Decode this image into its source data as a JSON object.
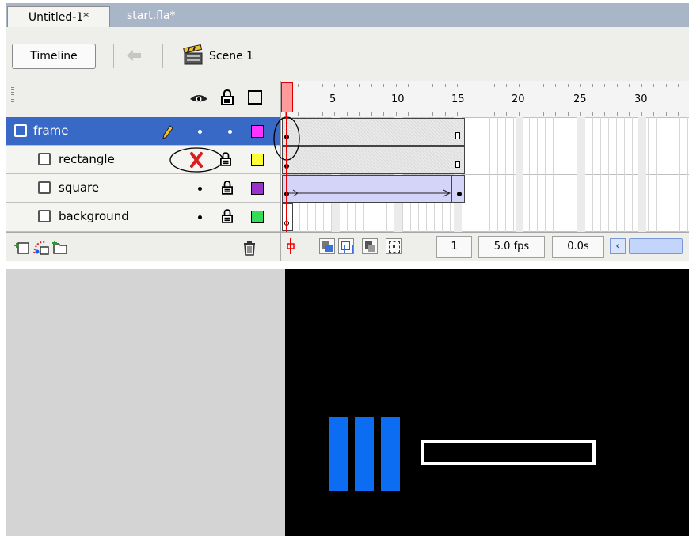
{
  "tabs": [
    {
      "label": "Untitled-1*",
      "active": true
    },
    {
      "label": "start.fla*",
      "active": false
    }
  ],
  "toolbar": {
    "timeline_label": "Timeline",
    "scene_label": "Scene 1"
  },
  "ruler": {
    "labels": [
      "1",
      "5",
      "10",
      "15",
      "20",
      "25",
      "30"
    ]
  },
  "layers": [
    {
      "name": "frame",
      "selected": true,
      "visibility": "pencil",
      "lock": "dot",
      "color": "#ff33ff",
      "frames": "tween"
    },
    {
      "name": "rectangle",
      "selected": false,
      "visibility": "hidden-x",
      "lock": "lock",
      "color": "#ffff33",
      "frames": "tween"
    },
    {
      "name": "square",
      "selected": false,
      "visibility": "dot",
      "lock": "lock",
      "color": "#9933cc",
      "frames": "motion"
    },
    {
      "name": "background",
      "selected": false,
      "visibility": "dot",
      "lock": "lock",
      "color": "#33dd55",
      "frames": "single"
    }
  ],
  "timeline_status": {
    "current_frame": "1",
    "frame_rate": "5.0 fps",
    "elapsed": "0.0s"
  },
  "icons": {
    "eye": "eye-icon",
    "lock": "lock-icon",
    "outline": "outline-icon",
    "insert_layer": "insert-layer-icon",
    "motion_guide": "add-motion-guide-icon",
    "insert_folder": "insert-folder-icon",
    "trash": "trash-icon",
    "pencil": "pencil-icon",
    "hidden": "hidden-x-icon"
  },
  "stage": {
    "background": "#000000",
    "bar_color": "#0c6cf2",
    "outline_color": "#ffffff"
  }
}
